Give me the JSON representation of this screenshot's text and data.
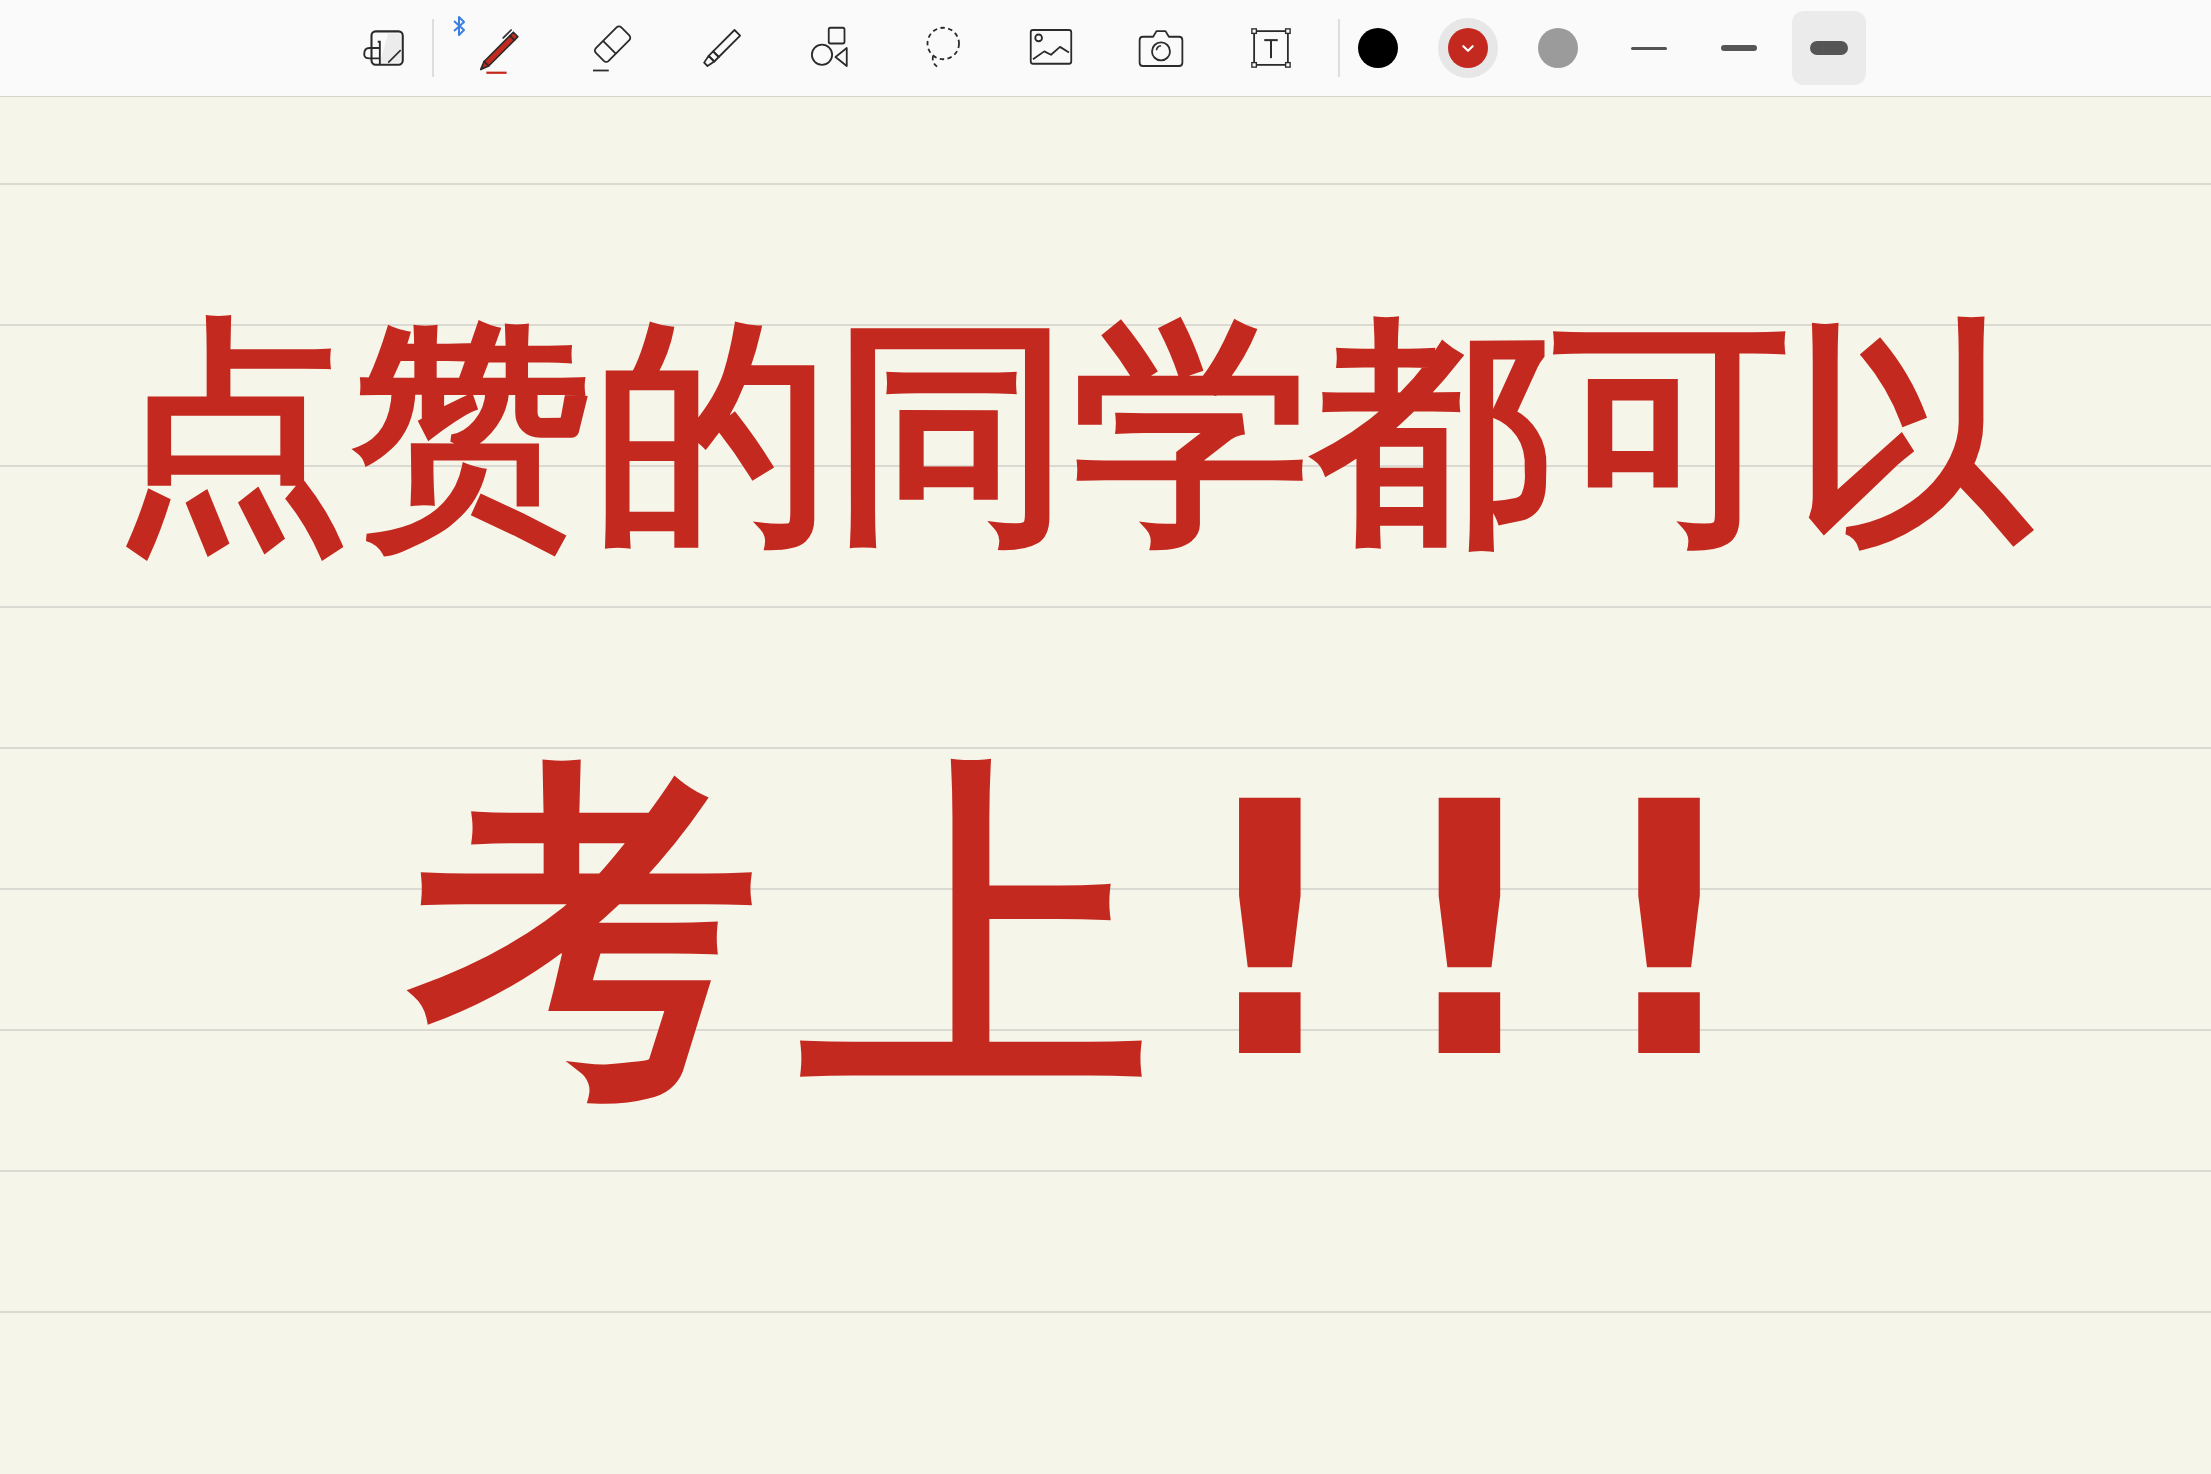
{
  "toolbar": {
    "bluetooth_connected": true,
    "tools": [
      {
        "kind": "pen",
        "selected": true
      },
      {
        "kind": "eraser",
        "selected": false
      },
      {
        "kind": "highlighter",
        "selected": false
      },
      {
        "kind": "shapes",
        "selected": false
      },
      {
        "kind": "lasso",
        "selected": false
      },
      {
        "kind": "image",
        "selected": false
      },
      {
        "kind": "camera",
        "selected": false
      },
      {
        "kind": "text",
        "selected": false
      }
    ],
    "colors": [
      {
        "color": "#000000",
        "selected": false
      },
      {
        "color": "#c4291f",
        "selected": true
      },
      {
        "color": "#9b9b9b",
        "selected": false
      }
    ],
    "widths": [
      {
        "kind": "thin",
        "selected": false
      },
      {
        "kind": "medium",
        "selected": false
      },
      {
        "kind": "thick",
        "selected": true
      }
    ]
  },
  "note": {
    "handwriting": {
      "line_1": "点赞的同学都可以",
      "line_2": "考上!!!"
    }
  }
}
